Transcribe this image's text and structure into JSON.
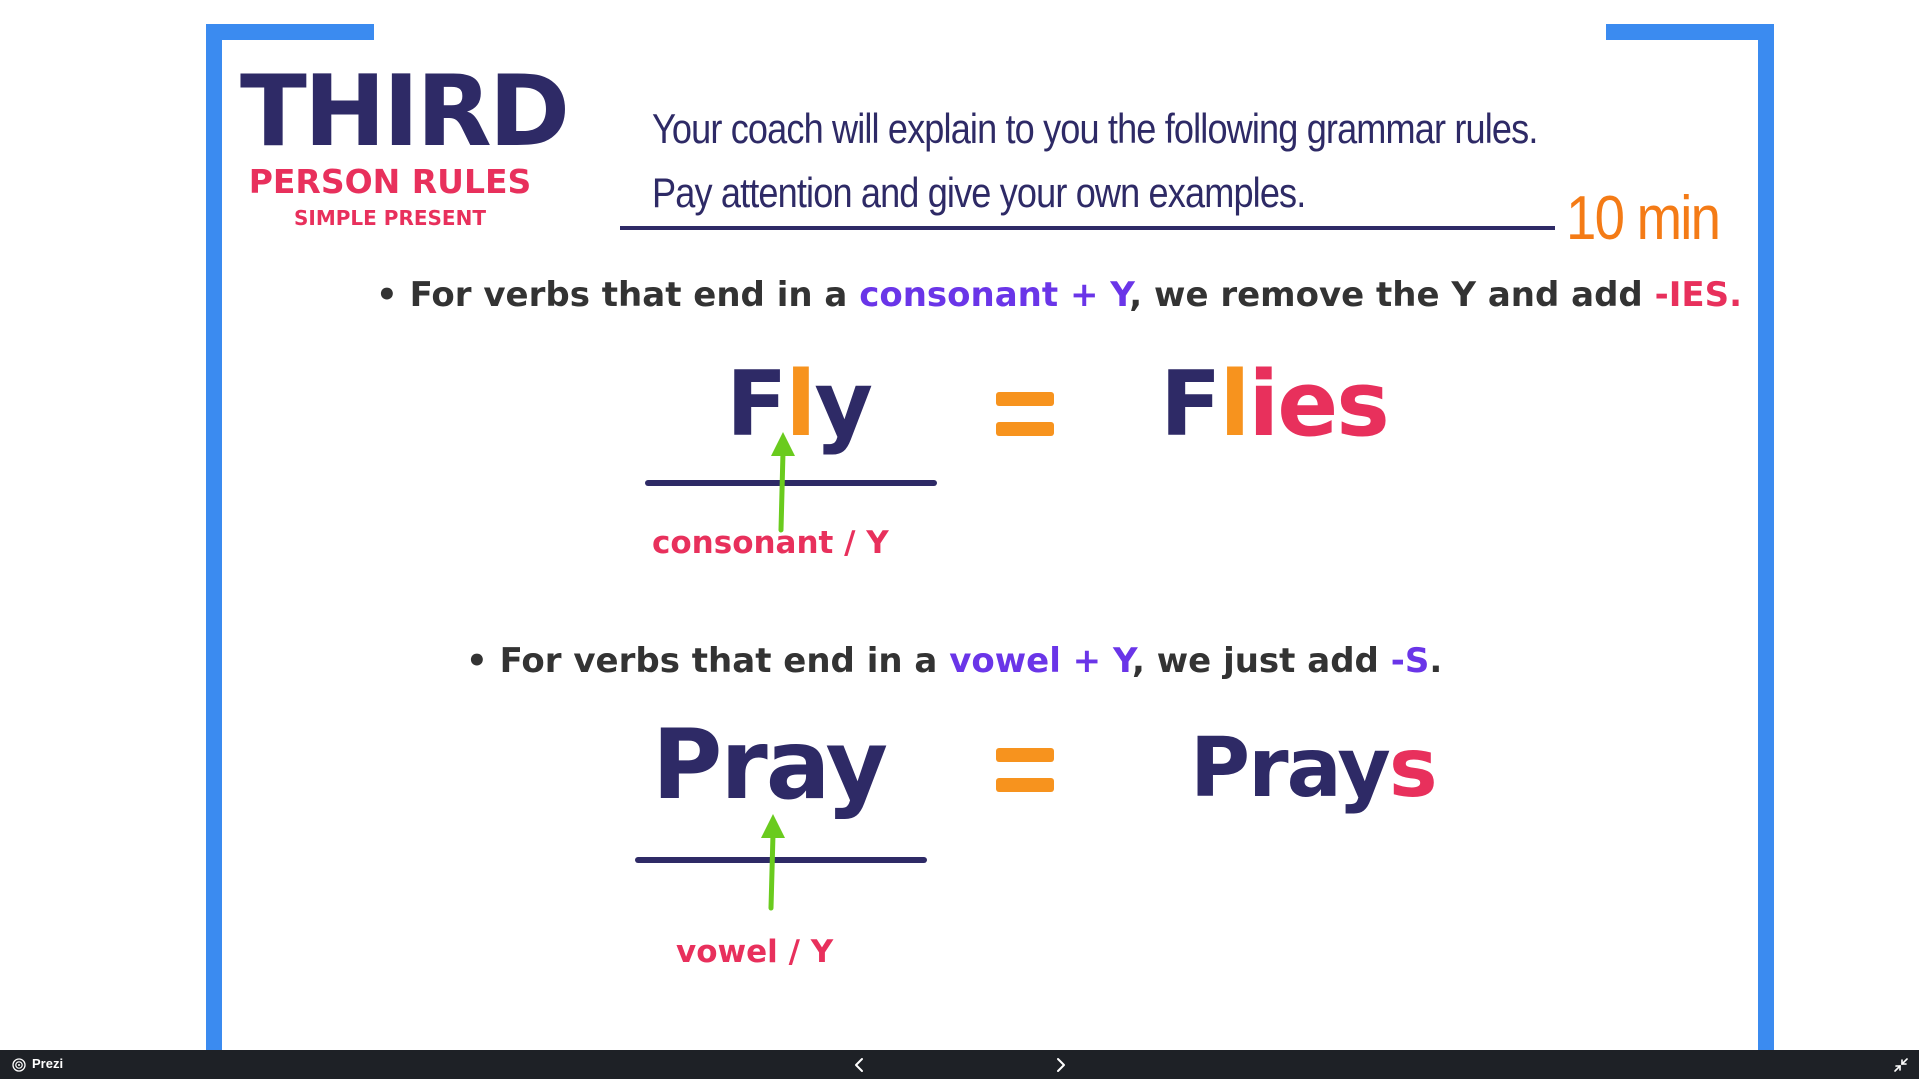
{
  "slide": {
    "title": "THIRD",
    "subtitle": "PERSON RULES",
    "subtitle2": "SIMPLE PRESENT",
    "instruction_line1": "Your coach will explain to you the following grammar rules.",
    "instruction_line2": "Pay attention and give your own examples.",
    "timer": "10 min",
    "rule1": {
      "bullet": "•",
      "text_a": "For verbs that end in a ",
      "highlight_a": "consonant + Y",
      "text_b": ", we remove the Y and add ",
      "highlight_b": "-IES."
    },
    "example1": {
      "base_part1": "F",
      "base_part2": "l",
      "base_part3": "y",
      "equals": "=",
      "result_part1": "F",
      "result_part2": "l",
      "result_part3": "ies",
      "label": "consonant / Y"
    },
    "rule2": {
      "bullet": "•",
      "text_a": "For verbs that end in a ",
      "highlight_a": "vowel + Y",
      "text_b": ", we just add ",
      "highlight_b": "-S",
      "text_c": "."
    },
    "example2": {
      "base": "Pray",
      "equals": "=",
      "result_part1": "Pray",
      "result_part2": "s",
      "label": "vowel / Y"
    }
  },
  "bottombar": {
    "app_name": "Prezi",
    "prev_icon": "chevron-left-icon",
    "next_icon": "chevron-right-icon",
    "fullscreen_icon": "exit-fullscreen-icon"
  },
  "colors": {
    "frame": "#3b8bf0",
    "navy": "#2e2a66",
    "pink": "#e8305c",
    "purple": "#6a35e8",
    "orange": "#f7931e",
    "timer": "#f47b16",
    "arrow": "#6acb1e",
    "bar": "#1e2126"
  }
}
